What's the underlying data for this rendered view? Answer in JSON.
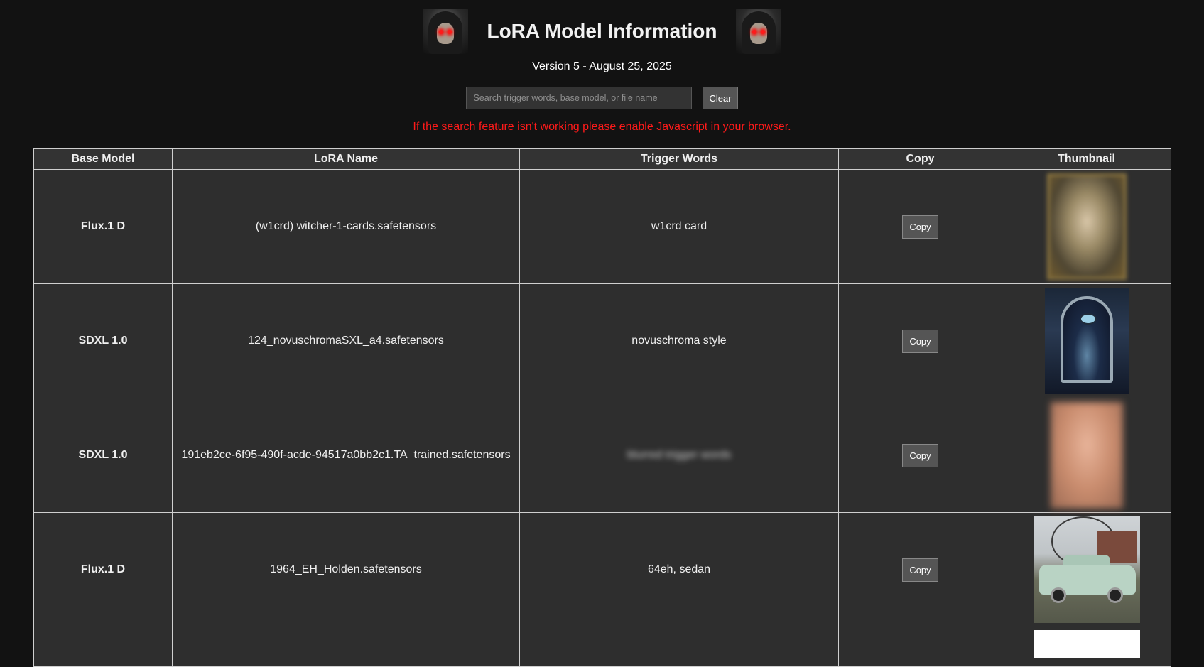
{
  "header": {
    "title": "LoRA Model Information",
    "logo_icon": "hooded-skull-icon",
    "version": "Version 5 - August 25, 2025"
  },
  "search": {
    "placeholder": "Search trigger words, base model, or file name",
    "value": "",
    "clear_label": "Clear"
  },
  "warning": "If the search feature isn't working please enable Javascript in your browser.",
  "colors": {
    "background": "#121212",
    "warning": "#ff1a1a",
    "cell": "#2e2e2e",
    "header_cell": "#333333"
  },
  "table": {
    "columns": [
      "Base Model",
      "LoRA Name",
      "Trigger Words",
      "Copy",
      "Thumbnail"
    ],
    "copy_label": "Copy",
    "rows": [
      {
        "base": "Flux.1 D",
        "name": "(w1crd) witcher-1-cards.safetensors",
        "trigger": "w1crd card",
        "thumb": "card-thumbnail"
      },
      {
        "base": "SDXL 1.0",
        "name": "124_novuschromaSXL_a4.safetensors",
        "trigger": "novuschroma style",
        "thumb": "mystic-arch-thumbnail"
      },
      {
        "base": "SDXL 1.0",
        "name": "191eb2ce-6f95-490f-acde-94517a0bb2c1.TA_trained.safetensors",
        "trigger": "blurred trigger words",
        "thumb": "blurred-thumbnail"
      },
      {
        "base": "Flux.1 D",
        "name": "1964_EH_Holden.safetensors",
        "trigger": "64eh, sedan",
        "thumb": "car-thumbnail"
      }
    ]
  }
}
